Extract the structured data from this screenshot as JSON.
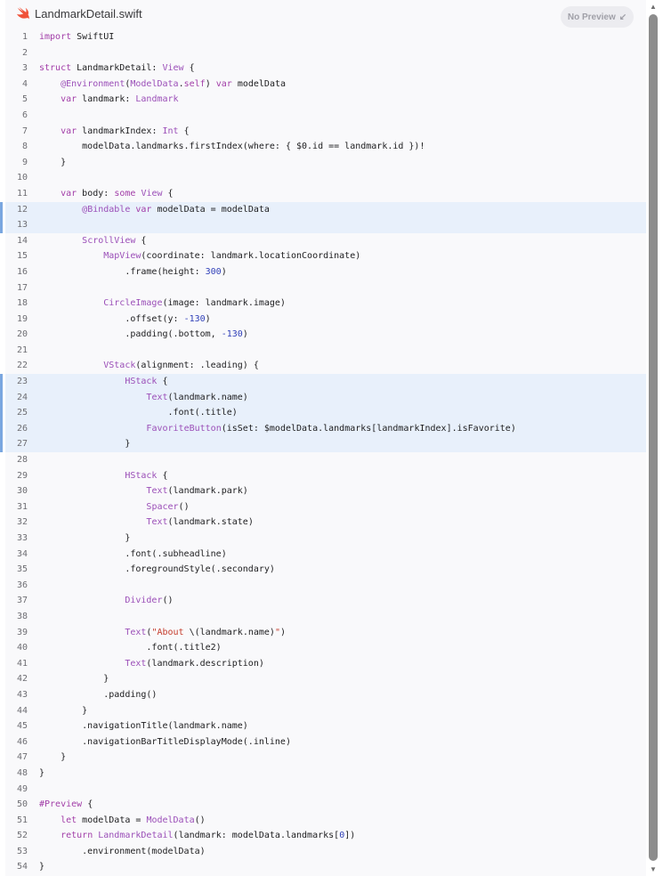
{
  "header": {
    "filename": "LandmarkDetail.swift",
    "preview_label": "No Preview"
  },
  "code": {
    "highlighted_lines": [
      12,
      13,
      23,
      24,
      25,
      26,
      27
    ],
    "lines": [
      [
        [
          "k",
          "import"
        ],
        [
          "p",
          " SwiftUI"
        ]
      ],
      [],
      [
        [
          "k",
          "struct"
        ],
        [
          "p",
          " LandmarkDetail: "
        ],
        [
          "t",
          "View"
        ],
        [
          "p",
          " {"
        ]
      ],
      [
        [
          "p",
          "    "
        ],
        [
          "t",
          "@Environment"
        ],
        [
          "p",
          "("
        ],
        [
          "t",
          "ModelData"
        ],
        [
          "p",
          "."
        ],
        [
          "k",
          "self"
        ],
        [
          "p",
          ") "
        ],
        [
          "k",
          "var"
        ],
        [
          "p",
          " modelData"
        ]
      ],
      [
        [
          "p",
          "    "
        ],
        [
          "k",
          "var"
        ],
        [
          "p",
          " landmark: "
        ],
        [
          "t",
          "Landmark"
        ]
      ],
      [],
      [
        [
          "p",
          "    "
        ],
        [
          "k",
          "var"
        ],
        [
          "p",
          " landmarkIndex: "
        ],
        [
          "t",
          "Int"
        ],
        [
          "p",
          " {"
        ]
      ],
      [
        [
          "p",
          "        modelData.landmarks.firstIndex(where: { $0.id == landmark.id })!"
        ]
      ],
      [
        [
          "p",
          "    }"
        ]
      ],
      [],
      [
        [
          "p",
          "    "
        ],
        [
          "k",
          "var"
        ],
        [
          "p",
          " body: "
        ],
        [
          "k",
          "some"
        ],
        [
          "p",
          " "
        ],
        [
          "t",
          "View"
        ],
        [
          "p",
          " {"
        ]
      ],
      [
        [
          "p",
          "        "
        ],
        [
          "t",
          "@Bindable"
        ],
        [
          "p",
          " "
        ],
        [
          "k",
          "var"
        ],
        [
          "p",
          " modelData = modelData"
        ]
      ],
      [],
      [
        [
          "p",
          "        "
        ],
        [
          "t",
          "ScrollView"
        ],
        [
          "p",
          " {"
        ]
      ],
      [
        [
          "p",
          "            "
        ],
        [
          "t",
          "MapView"
        ],
        [
          "p",
          "(coordinate: landmark.locationCoordinate)"
        ]
      ],
      [
        [
          "p",
          "                .frame(height: "
        ],
        [
          "n",
          "300"
        ],
        [
          "p",
          ")"
        ]
      ],
      [],
      [
        [
          "p",
          "            "
        ],
        [
          "t",
          "CircleImage"
        ],
        [
          "p",
          "(image: landmark.image)"
        ]
      ],
      [
        [
          "p",
          "                .offset(y: "
        ],
        [
          "n",
          "-130"
        ],
        [
          "p",
          ")"
        ]
      ],
      [
        [
          "p",
          "                .padding(.bottom, "
        ],
        [
          "n",
          "-130"
        ],
        [
          "p",
          ")"
        ]
      ],
      [],
      [
        [
          "p",
          "            "
        ],
        [
          "t",
          "VStack"
        ],
        [
          "p",
          "(alignment: .leading) {"
        ]
      ],
      [
        [
          "p",
          "                "
        ],
        [
          "t",
          "HStack"
        ],
        [
          "p",
          " {"
        ]
      ],
      [
        [
          "p",
          "                    "
        ],
        [
          "t",
          "Text"
        ],
        [
          "p",
          "(landmark.name)"
        ]
      ],
      [
        [
          "p",
          "                        .font(.title)"
        ]
      ],
      [
        [
          "p",
          "                    "
        ],
        [
          "t",
          "FavoriteButton"
        ],
        [
          "p",
          "(isSet: $modelData.landmarks[landmarkIndex].isFavorite)"
        ]
      ],
      [
        [
          "p",
          "                }"
        ]
      ],
      [],
      [
        [
          "p",
          "                "
        ],
        [
          "t",
          "HStack"
        ],
        [
          "p",
          " {"
        ]
      ],
      [
        [
          "p",
          "                    "
        ],
        [
          "t",
          "Text"
        ],
        [
          "p",
          "(landmark.park)"
        ]
      ],
      [
        [
          "p",
          "                    "
        ],
        [
          "t",
          "Spacer"
        ],
        [
          "p",
          "()"
        ]
      ],
      [
        [
          "p",
          "                    "
        ],
        [
          "t",
          "Text"
        ],
        [
          "p",
          "(landmark.state)"
        ]
      ],
      [
        [
          "p",
          "                }"
        ]
      ],
      [
        [
          "p",
          "                .font(.subheadline)"
        ]
      ],
      [
        [
          "p",
          "                .foregroundStyle(.secondary)"
        ]
      ],
      [],
      [
        [
          "p",
          "                "
        ],
        [
          "t",
          "Divider"
        ],
        [
          "p",
          "()"
        ]
      ],
      [],
      [
        [
          "p",
          "                "
        ],
        [
          "t",
          "Text"
        ],
        [
          "p",
          "("
        ],
        [
          "s",
          "\"About "
        ],
        [
          "p",
          "\\(landmark.name)"
        ],
        [
          "s",
          "\""
        ],
        [
          "p",
          ")"
        ]
      ],
      [
        [
          "p",
          "                    .font(.title2)"
        ]
      ],
      [
        [
          "p",
          "                "
        ],
        [
          "t",
          "Text"
        ],
        [
          "p",
          "(landmark.description)"
        ]
      ],
      [
        [
          "p",
          "            }"
        ]
      ],
      [
        [
          "p",
          "            .padding()"
        ]
      ],
      [
        [
          "p",
          "        }"
        ]
      ],
      [
        [
          "p",
          "        .navigationTitle(landmark.name)"
        ]
      ],
      [
        [
          "p",
          "        .navigationBarTitleDisplayMode(.inline)"
        ]
      ],
      [
        [
          "p",
          "    }"
        ]
      ],
      [
        [
          "p",
          "}"
        ]
      ],
      [],
      [
        [
          "k",
          "#Preview"
        ],
        [
          "p",
          " {"
        ]
      ],
      [
        [
          "p",
          "    "
        ],
        [
          "k",
          "let"
        ],
        [
          "p",
          " modelData = "
        ],
        [
          "t",
          "ModelData"
        ],
        [
          "p",
          "()"
        ]
      ],
      [
        [
          "p",
          "    "
        ],
        [
          "k",
          "return"
        ],
        [
          "p",
          " "
        ],
        [
          "t",
          "LandmarkDetail"
        ],
        [
          "p",
          "(landmark: modelData.landmarks["
        ],
        [
          "n",
          "0"
        ],
        [
          "p",
          "])"
        ]
      ],
      [
        [
          "p",
          "        .environment(modelData)"
        ]
      ],
      [
        [
          "p",
          "}"
        ]
      ]
    ]
  },
  "icons": {
    "file_icon": "swift-icon",
    "preview_icon": "arrow-down-left-icon"
  },
  "colors": {
    "keyword": "#a23ea8",
    "type": "#9b4fb8",
    "string": "#c43a2a",
    "number": "#2f3fb8",
    "highlight": "#e8f0fb",
    "swift_orange": "#f05138"
  }
}
